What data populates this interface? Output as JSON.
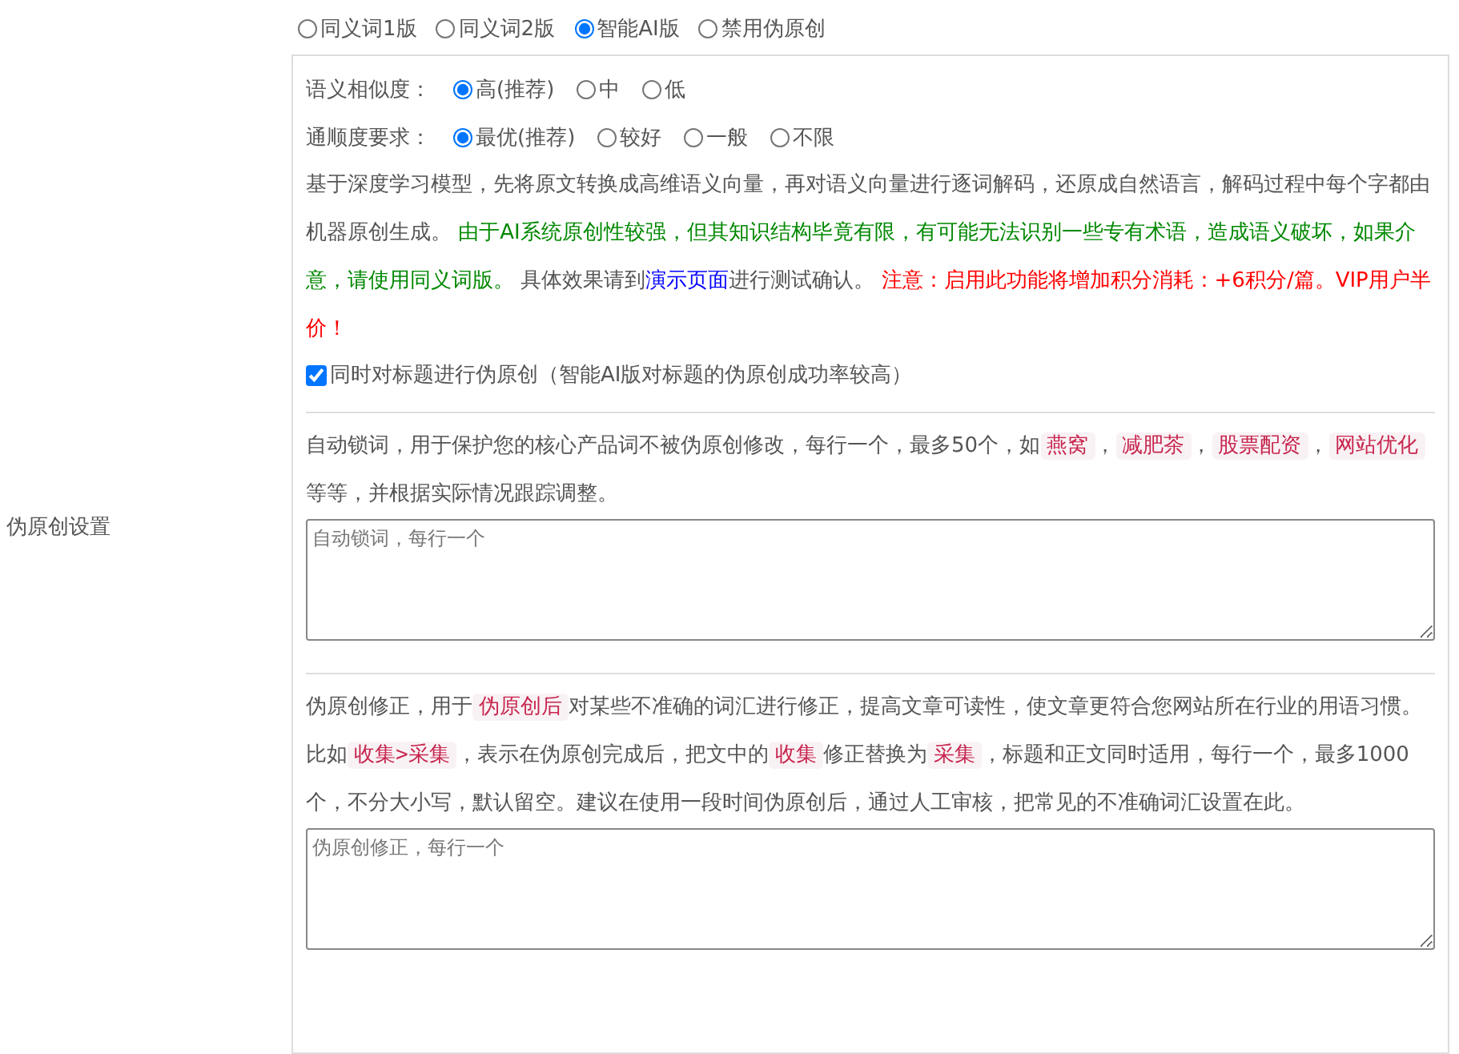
{
  "section_label": "伪原创设置",
  "version_options": [
    {
      "label": "同义词1版",
      "selected": false
    },
    {
      "label": "同义词2版",
      "selected": false
    },
    {
      "label": "智能AI版",
      "selected": true
    },
    {
      "label": "禁用伪原创",
      "selected": false
    }
  ],
  "ai_panel": {
    "similarity": {
      "label": "语义相似度：",
      "options": [
        {
          "label": "高(推荐)",
          "selected": true
        },
        {
          "label": "中",
          "selected": false
        },
        {
          "label": "低",
          "selected": false
        }
      ]
    },
    "fluency": {
      "label": "通顺度要求：",
      "options": [
        {
          "label": "最优(推荐)",
          "selected": true
        },
        {
          "label": "较好",
          "selected": false
        },
        {
          "label": "一般",
          "selected": false
        },
        {
          "label": "不限",
          "selected": false
        }
      ]
    },
    "description": [
      {
        "kind": "plain",
        "text": "基于深度学习模型，先将原文转换成高维语义向量，再对语义向量进行逐词解码，还原成自然语言，解码过程中每个字都由机器原创生成。 "
      },
      {
        "kind": "green",
        "text": "由于AI系统原创性较强，但其知识结构毕竟有限，有可能无法识别一些专有术语，造成语义破坏，如果介意，请使用同义词版。"
      },
      {
        "kind": "plain",
        "text": " 具体效果请到"
      },
      {
        "kind": "link",
        "text": "演示页面"
      },
      {
        "kind": "plain",
        "text": "进行测试确认。 "
      },
      {
        "kind": "red",
        "text": "注意：启用此功能将增加积分消耗：+6积分/篇。VIP用户半价！"
      }
    ],
    "title_checkbox": {
      "label": "同时对标题进行伪原创（智能AI版对标题的伪原创成功率较高）",
      "checked": true
    }
  },
  "lock_words": {
    "description": [
      {
        "kind": "plain",
        "text": "自动锁词，用于保护您的核心产品词不被伪原创修改，每行一个，最多50个，如"
      },
      {
        "kind": "code",
        "text": "燕窝"
      },
      {
        "kind": "plain",
        "text": "，"
      },
      {
        "kind": "code",
        "text": "减肥茶"
      },
      {
        "kind": "plain",
        "text": "，"
      },
      {
        "kind": "code",
        "text": "股票配资"
      },
      {
        "kind": "plain",
        "text": "，"
      },
      {
        "kind": "code",
        "text": "网站优化"
      },
      {
        "kind": "plain",
        "text": " 等等，并根据实际情况跟踪调整。"
      }
    ],
    "placeholder": "自动锁词，每行一个"
  },
  "correction": {
    "description": [
      {
        "kind": "plain",
        "text": "伪原创修正，用于"
      },
      {
        "kind": "code",
        "text": "伪原创后"
      },
      {
        "kind": "plain",
        "text": "对某些不准确的词汇进行修正，提高文章可读性，使文章更符合您网站所在行业的用语习惯。比如"
      },
      {
        "kind": "code",
        "text": "收集>采集"
      },
      {
        "kind": "plain",
        "text": "，表示在伪原创完成后，把文中的"
      },
      {
        "kind": "code",
        "text": "收集"
      },
      {
        "kind": "plain",
        "text": "修正替换为"
      },
      {
        "kind": "code",
        "text": "采集"
      },
      {
        "kind": "plain",
        "text": "，标题和正文同时适用，每行一个，最多1000个，不分大小写，默认留空。建议在使用一段时间伪原创后，通过人工审核，把常见的不准确词汇设置在此。"
      }
    ],
    "placeholder": "伪原创修正，每行一个"
  }
}
